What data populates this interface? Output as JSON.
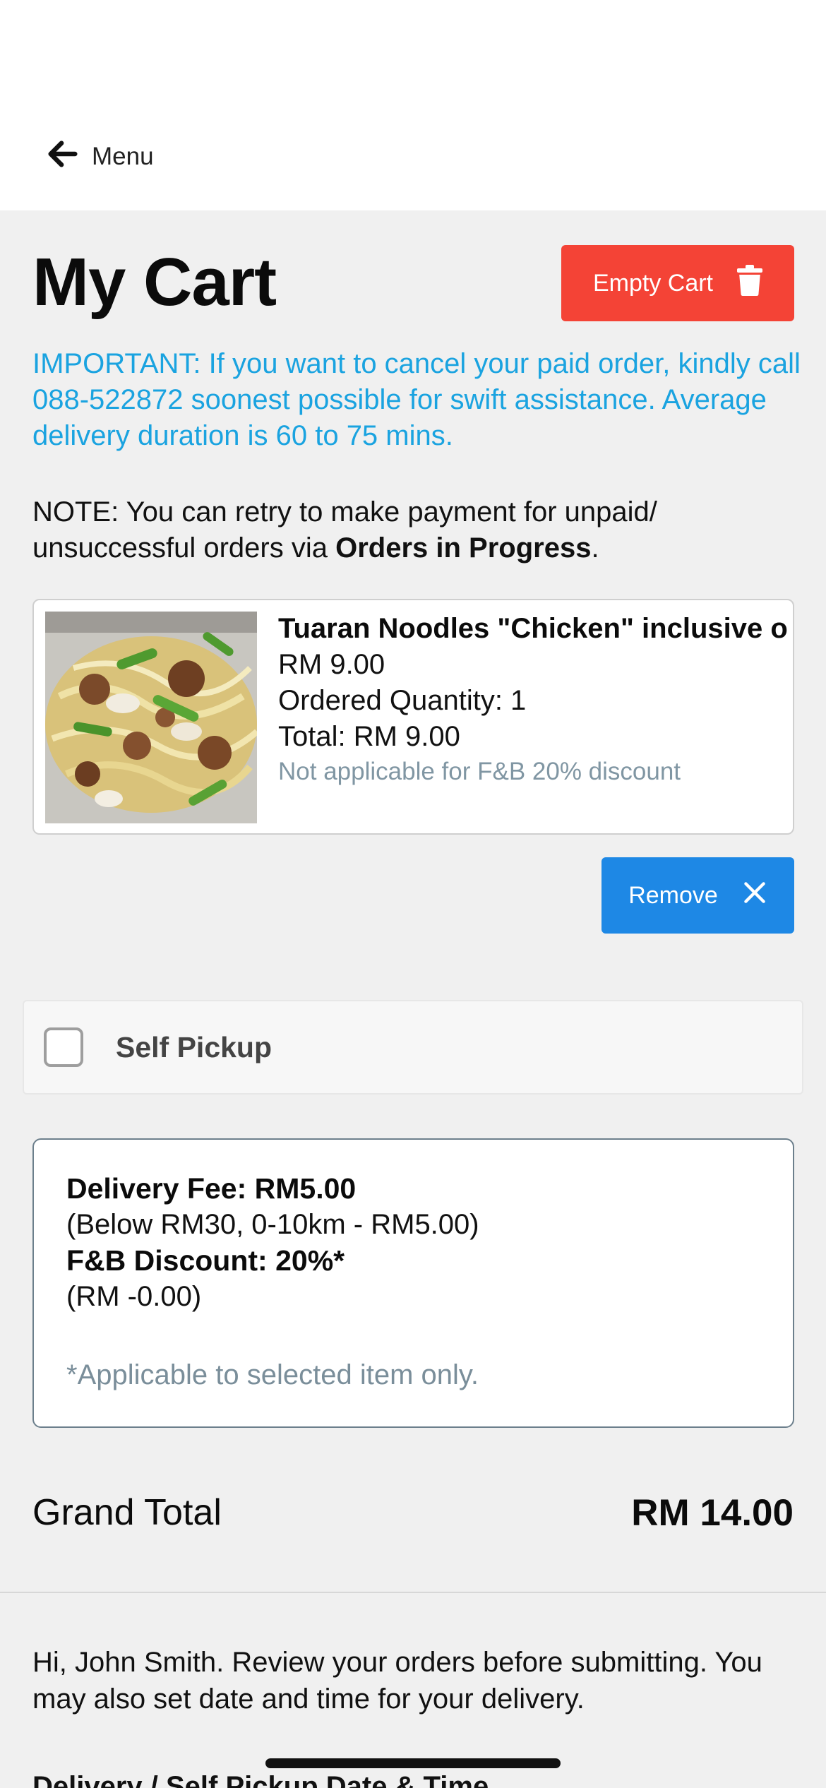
{
  "nav": {
    "back_label": "Menu"
  },
  "cart": {
    "title": "My Cart",
    "empty_cart_label": "Empty Cart",
    "important_text": "IMPORTANT: If you want to cancel your paid order, kindly call 088-522872 soonest possible for swift assistance. Average delivery duration is 60 to 75 mins.",
    "note_prefix": "NOTE: You can retry to make payment for unpaid/ unsuccessful orders via ",
    "note_link": "Orders in Progress",
    "note_suffix": "."
  },
  "items": [
    {
      "name": "Tuaran Noodles \"Chicken\" inclusive o",
      "price": "RM 9.00",
      "quantity": "Ordered Quantity: 1",
      "total": "Total: RM 9.00",
      "discount_note": "Not applicable for F&B 20% discount",
      "remove_label": "Remove"
    }
  ],
  "pickup": {
    "label": "Self Pickup",
    "checked": false
  },
  "fees": {
    "delivery_fee": "Delivery Fee: RM5.00",
    "delivery_detail": "(Below RM30, 0-10km - RM5.00)",
    "discount": "F&B Discount: 20%*",
    "discount_amount": "(RM  -0.00)",
    "footnote": "*Applicable to selected item only."
  },
  "summary": {
    "grand_total_label": "Grand Total",
    "grand_total_value": "RM 14.00"
  },
  "review": {
    "text": "Hi, John Smith. Review your orders before submitting. You may also set date and time for your delivery.",
    "next_heading": "Delivery / Self Pickup Date & Time"
  },
  "colors": {
    "danger": "#f44336",
    "primary": "#1e88e5",
    "info_text": "#1aa3e0",
    "muted_text": "#8096a3"
  },
  "icons": {
    "back": "arrow-left-icon",
    "empty_cart": "trash-icon",
    "remove": "close-icon"
  }
}
